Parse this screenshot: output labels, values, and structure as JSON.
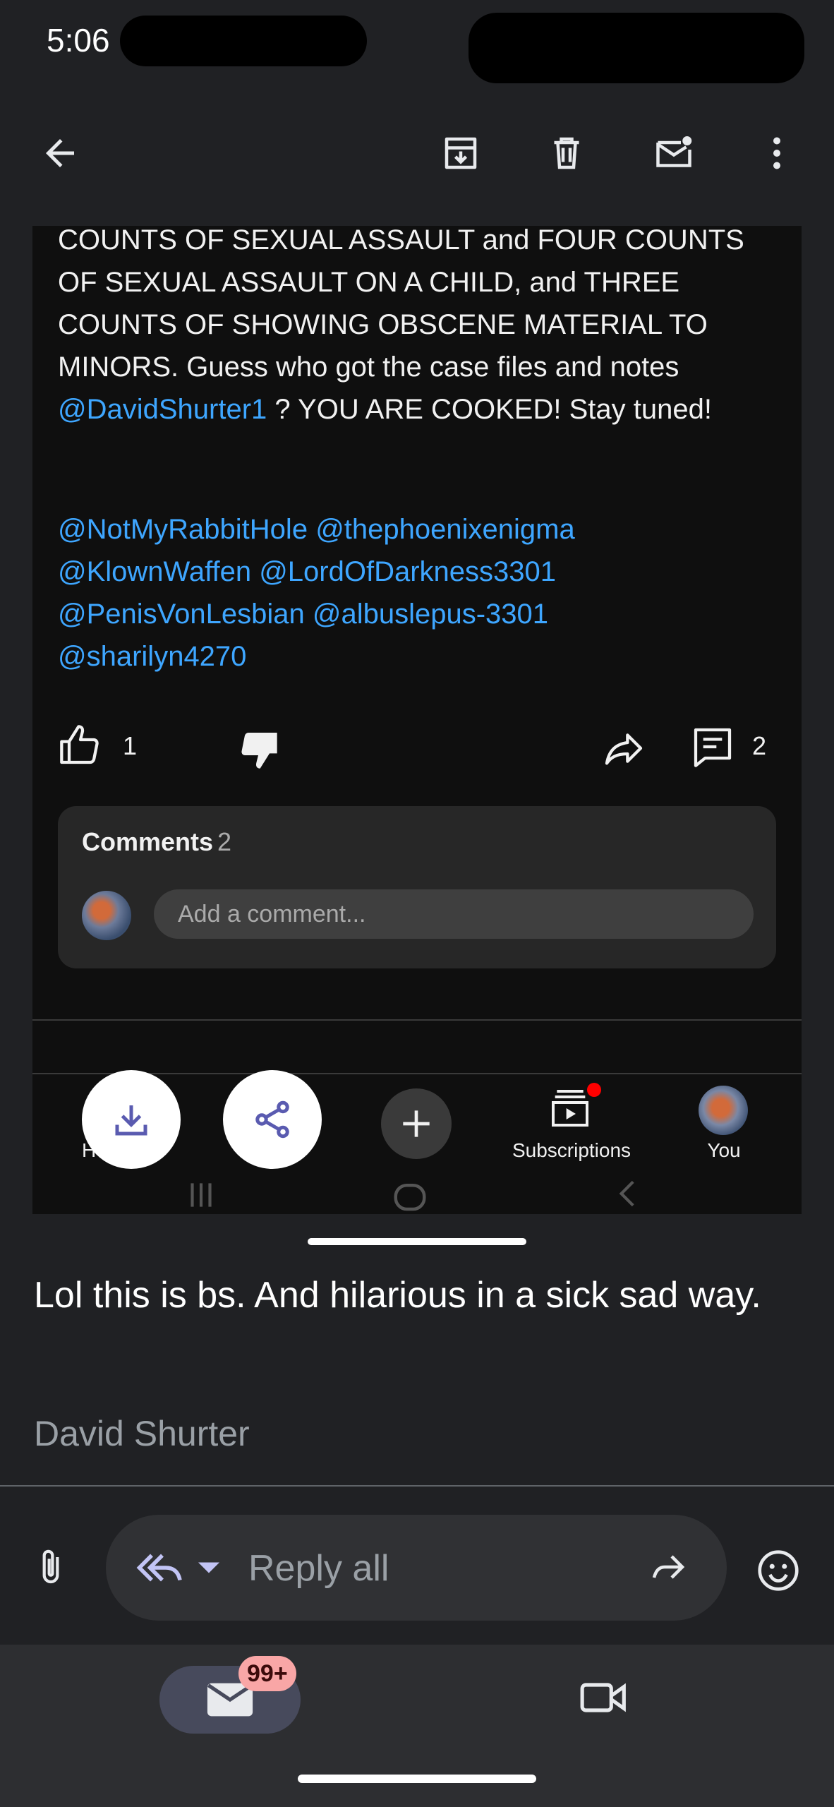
{
  "status_bar": {
    "time": "5:06"
  },
  "app_bar": {
    "icons": [
      "back-arrow-icon",
      "archive-icon",
      "trash-icon",
      "mark-unread-icon",
      "more-vert-icon"
    ]
  },
  "embedded_post": {
    "text_before_mention": "COUNTS OF SEXUAL ASSAULT and FOUR COUNTS OF SEXUAL ASSAULT ON A CHILD, and THREE COUNTS OF SHOWING OBSCENE MATERIAL TO MINORS. Guess who got the case files and notes ",
    "mention_inline": "@DavidShurter1",
    "text_after_mention": " ? YOU ARE COOKED! Stay tuned!",
    "mentions": [
      "@NotMyRabbitHole",
      "@thephoenixenigma",
      "@KlownWaffen",
      "@LordOfDarkness3301",
      "@PenisVonLesbian",
      "@albuslepus-3301",
      "@sharilyn4270"
    ],
    "likes": "1",
    "comment_count": "2",
    "comments_title": "Comments",
    "comments_count": "2",
    "comment_placeholder": "Add a comment...",
    "nav": {
      "subscriptions": "Subscriptions",
      "you": "You",
      "home_partial": "H"
    }
  },
  "email": {
    "reply_text": "Lol this is bs. And hilarious in a sick sad way.",
    "sender": "David Shurter"
  },
  "reply_bar": {
    "placeholder": "Reply all"
  },
  "bottom_nav": {
    "mail_badge": "99+"
  },
  "colors": {
    "accent": "#c2c4f5",
    "link": "#3ea6ff",
    "badge": "#f9a6a6"
  }
}
